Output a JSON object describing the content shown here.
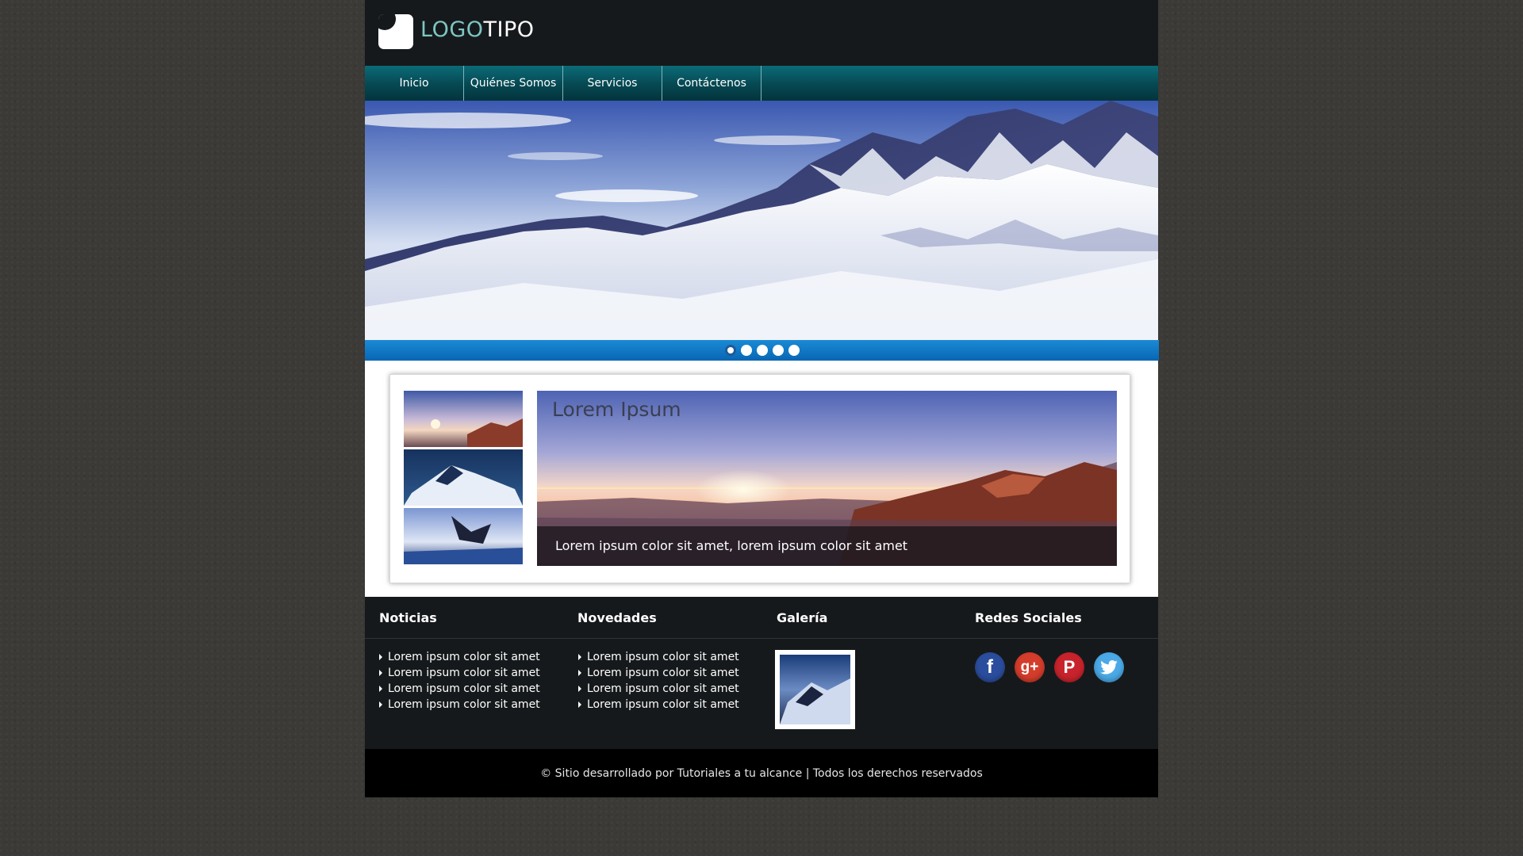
{
  "header": {
    "logo_part1": "LOGO",
    "logo_part2": "TIPO"
  },
  "nav": {
    "items": [
      "Inicio",
      "Quiénes Somos",
      "Servicios",
      "Contáctenos"
    ]
  },
  "slider": {
    "dot_count": 5,
    "active_index": 0
  },
  "feature": {
    "title": "Lorem Ipsum",
    "caption": "Lorem ipsum color sit amet, lorem ipsum color sit amet"
  },
  "footer": {
    "noticias": {
      "title": "Noticias",
      "items": [
        "Lorem ipsum color sit amet",
        "Lorem ipsum color sit amet",
        "Lorem ipsum color sit amet",
        "Lorem ipsum color sit amet"
      ]
    },
    "novedades": {
      "title": "Novedades",
      "items": [
        "Lorem ipsum color sit amet",
        "Lorem ipsum color sit amet",
        "Lorem ipsum color sit amet",
        "Lorem ipsum color sit amet"
      ]
    },
    "galeria": {
      "title": "Galería"
    },
    "redes": {
      "title": "Redes Sociales",
      "icons": [
        "facebook-icon",
        "google-plus-icon",
        "pinterest-icon",
        "twitter-icon"
      ]
    }
  },
  "copyright": "© Sitio desarrollado por Tutoriales a tu alcance  |  Todos los derechos reservados",
  "colors": {
    "nav": "#064852",
    "slider_bar": "#0966b3",
    "logo_accent": "#7ec6c3",
    "facebook": "#2b4d9d",
    "google_plus": "#d43c2b",
    "pinterest": "#c8232c",
    "twitter": "#4aa9e6"
  }
}
